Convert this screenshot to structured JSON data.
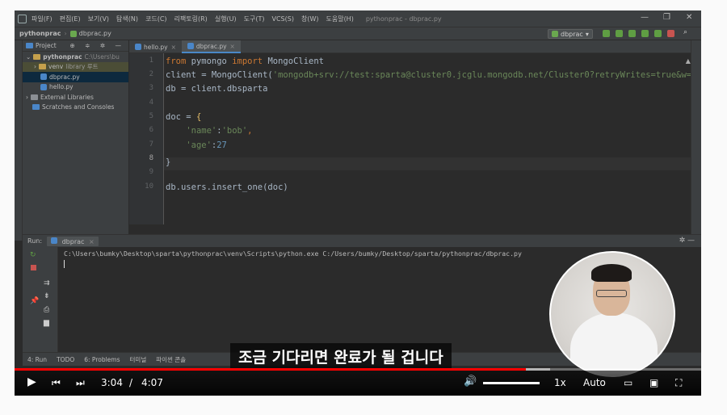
{
  "ide": {
    "menu": [
      "파일(F)",
      "편집(E)",
      "보기(V)",
      "탐색(N)",
      "코드(C)",
      "리팩토링(R)",
      "실행(U)",
      "도구(T)",
      "VCS(S)",
      "창(W)",
      "도움말(H)"
    ],
    "window_title": "pythonprac - dbprac.py",
    "breadcrumb": [
      "pythonprac",
      "dbprac.py"
    ],
    "run_config": "dbprac",
    "project_panel_title": "Project",
    "tree": [
      {
        "label": "pythonprac",
        "hint": "C:\\Users\\bu"
      },
      {
        "label": "venv",
        "hint": "library 루트"
      },
      {
        "label": "dbprac.py",
        "hint": ""
      },
      {
        "label": "hello.py",
        "hint": ""
      },
      {
        "label": "External Libraries",
        "hint": ""
      },
      {
        "label": "Scratches and Consoles",
        "hint": ""
      }
    ],
    "tabs": [
      "hello.py",
      "dbprac.py"
    ],
    "code": {
      "l1": {
        "kw1": "from",
        "mod": " pymongo ",
        "kw2": "import",
        "cls": " MongoClient"
      },
      "l2": {
        "pre": "client = MongoClient(",
        "str": "'mongodb+srv://test:sparta@cluster0.jcglu.mongodb.net/Cluster0?retryWrites=true&w=ma"
      },
      "l3": "db = client.dbsparta",
      "l5": {
        "pre": "doc = ",
        "brace": "{"
      },
      "l6": {
        "key": "'name'",
        "mid": ":",
        "val": "'bob'",
        "end": ","
      },
      "l7": {
        "key": "'age'",
        "mid": ":",
        "val": "27"
      },
      "l8": "}",
      "l10": "db.users.insert_one(doc)"
    },
    "line_numbers": [
      "1",
      "2",
      "3",
      "4",
      "5",
      "6",
      "7",
      "8",
      "9",
      "10"
    ],
    "warning_count": "▲3",
    "run_label": "Run:",
    "run_tab": "dbprac",
    "console_cmd": "C:\\Users\\bumky\\Desktop\\sparta\\pythonprac\\venv\\Scripts\\python.exe C:/Users/bumky/Desktop/sparta/pythonprac/dbprac.py",
    "bottom_tabs": [
      "4: Run",
      "TODO",
      "6: Problems",
      "터미널",
      "파이썬 콘솔"
    ]
  },
  "video": {
    "subtitle": "조금 기다리면 완료가 될 겁니다",
    "time_current": "3:04",
    "time_sep": "/",
    "time_total": "4:07",
    "speed": "1x",
    "quality": "Auto",
    "played_fraction": 0.745,
    "loaded_fraction": 0.78
  },
  "colors": {
    "accent": "#ff0000",
    "ide_bg": "#2b2b2b",
    "keyword": "#cc7832",
    "string": "#6a8759",
    "number": "#6897bb"
  }
}
